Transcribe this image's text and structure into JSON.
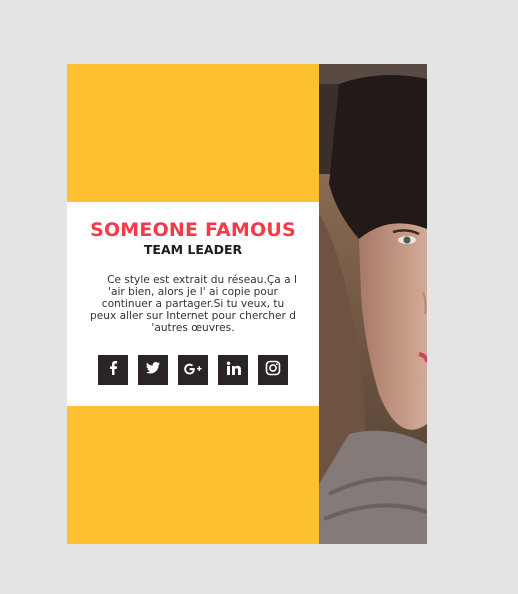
{
  "profile": {
    "name": "SOMEONE FAMOUS",
    "role": "TEAM LEADER",
    "description": "Ce style est extrait du réseau.Ça a l 'air bien, alors je l' ai copie pour continuer a partager.Si tu veux, tu peux aller sur Internet pour chercher d 'autres œuvres."
  },
  "social_links": [
    {
      "name": "facebook-icon"
    },
    {
      "name": "twitter-icon"
    },
    {
      "name": "google-plus-icon"
    },
    {
      "name": "linkedin-icon"
    },
    {
      "name": "instagram-icon"
    }
  ],
  "colors": {
    "accent": "#fdc030",
    "name_color": "#f63a49",
    "button_bg": "#2b2424",
    "page_bg": "#e4e4e4"
  }
}
